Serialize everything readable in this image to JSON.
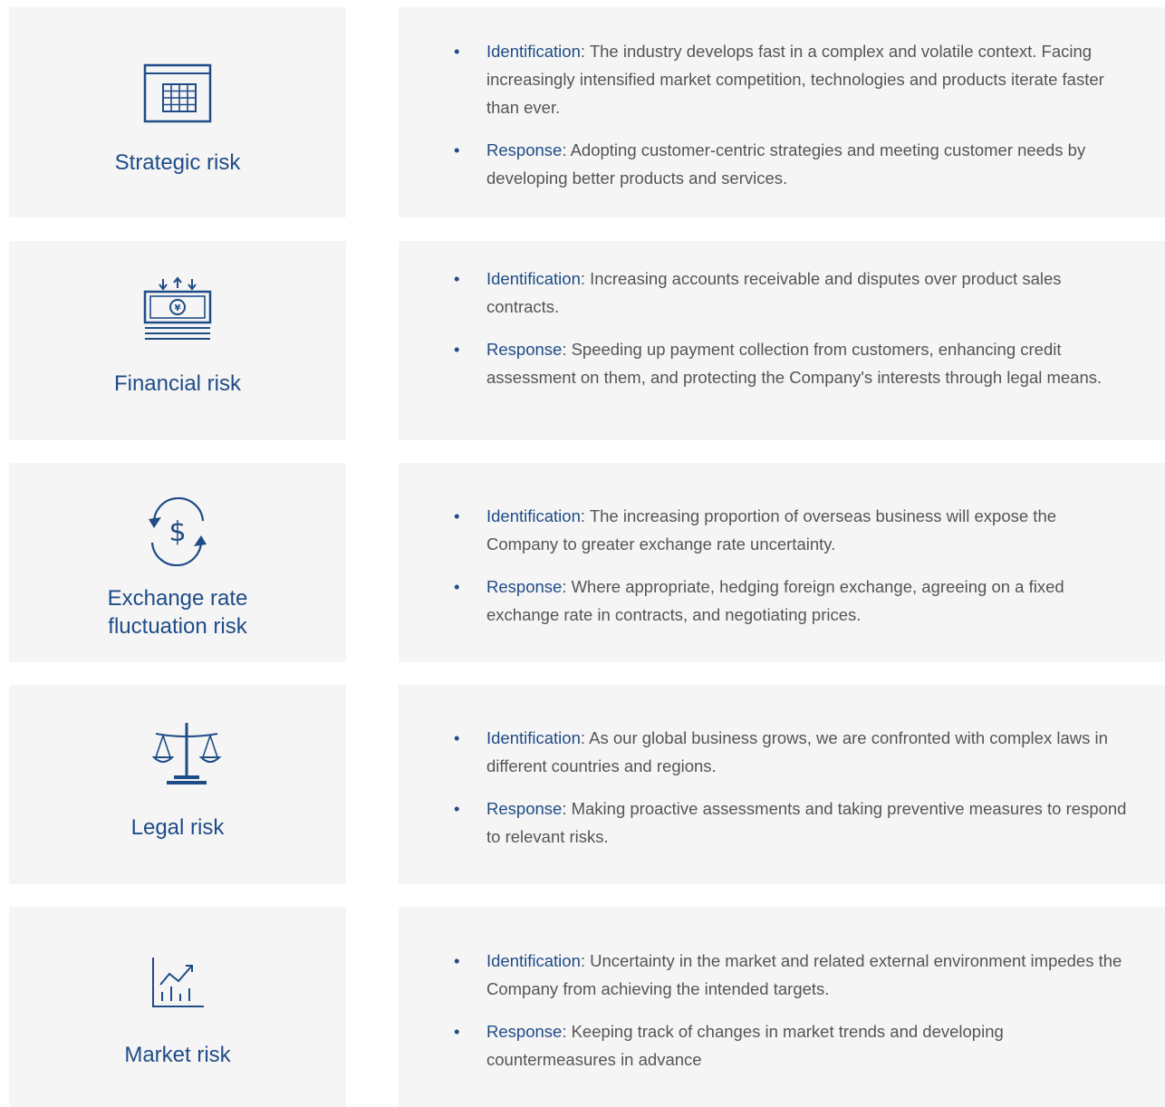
{
  "colors": {
    "accent": "#1f4c87",
    "card": "#f5f5f5",
    "text": "#555555"
  },
  "risks": [
    {
      "icon": "calendar-grid-icon",
      "title": "Strategic risk",
      "identification_label": "Identification",
      "identification": ": The industry develops fast in a complex and volatile context. Facing increasingly intensified market competition, technologies and products iterate faster than ever.",
      "response_label": "Response",
      "response": ": Adopting customer-centric strategies and meeting customer needs by developing better products and services."
    },
    {
      "icon": "banknote-icon",
      "title": "Financial risk",
      "identification_label": "Identification",
      "identification": ": Increasing accounts receivable and disputes over product sales contracts.",
      "response_label": "Response",
      "response": ": Speeding up payment collection from customers, enhancing credit assessment on them, and protecting the Company's interests through legal means."
    },
    {
      "icon": "currency-exchange-icon",
      "title": "Exchange rate fluctuation risk",
      "identification_label": "Identification",
      "identification": ": The increasing proportion of overseas business will expose the Company to greater exchange rate uncertainty.",
      "response_label": "Response",
      "response": ": Where appropriate, hedging foreign exchange, agreeing on a fixed exchange rate in contracts, and negotiating prices."
    },
    {
      "icon": "scales-icon",
      "title": "Legal risk",
      "identification_label": "Identification",
      "identification": ": As our global business grows, we are confronted with complex laws in different countries and regions.",
      "response_label": "Response",
      "response": ": Making proactive assessments and taking preventive measures to respond to relevant risks."
    },
    {
      "icon": "market-chart-icon",
      "title": "Market risk",
      "identification_label": "Identification",
      "identification": ": Uncertainty in the market and related external environment impedes the Company from achieving the intended targets.",
      "response_label": "Response",
      "response": ": Keeping track of changes in market trends and developing countermeasures in advance"
    }
  ],
  "bullet": "•"
}
